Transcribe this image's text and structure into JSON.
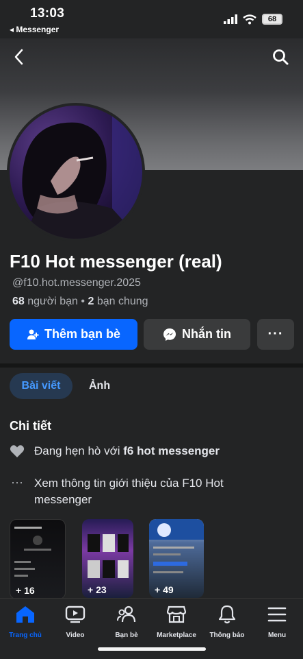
{
  "status_bar": {
    "time": "13:03",
    "back_app": "◂ Messenger",
    "battery": "68"
  },
  "profile": {
    "name": "F10 Hot messenger (real)",
    "username": "@f10.hot.messenger.2025",
    "friends_count": "68",
    "friends_label": "người bạn",
    "mutual_count": "2",
    "mutual_label": "bạn chung"
  },
  "actions": {
    "add_friend": "Thêm bạn bè",
    "message": "Nhắn tin",
    "more": "···"
  },
  "tabs": [
    {
      "label": "Bài viết",
      "active": true
    },
    {
      "label": "Ảnh",
      "active": false
    }
  ],
  "details": {
    "title": "Chi tiết",
    "relationship_prefix": "Đang hẹn hò với ",
    "relationship_partner": "f6 hot messenger",
    "about": "Xem thông tin giới thiệu của F10 Hot messenger"
  },
  "photos": [
    {
      "count": "+ 16"
    },
    {
      "count": "+ 23"
    },
    {
      "count": "+ 49"
    }
  ],
  "bottom_nav": [
    {
      "label": "Trang chủ",
      "icon": "home-icon",
      "active": true
    },
    {
      "label": "Video",
      "icon": "video-icon"
    },
    {
      "label": "Bạn bè",
      "icon": "friends-icon"
    },
    {
      "label": "Marketplace",
      "icon": "marketplace-icon"
    },
    {
      "label": "Thông báo",
      "icon": "bell-icon"
    },
    {
      "label": "Menu",
      "icon": "menu-icon"
    }
  ],
  "colors": {
    "accent": "#0866ff",
    "background": "#232425",
    "button_gray": "#3a3b3c",
    "active_tab_bg": "#263951"
  }
}
